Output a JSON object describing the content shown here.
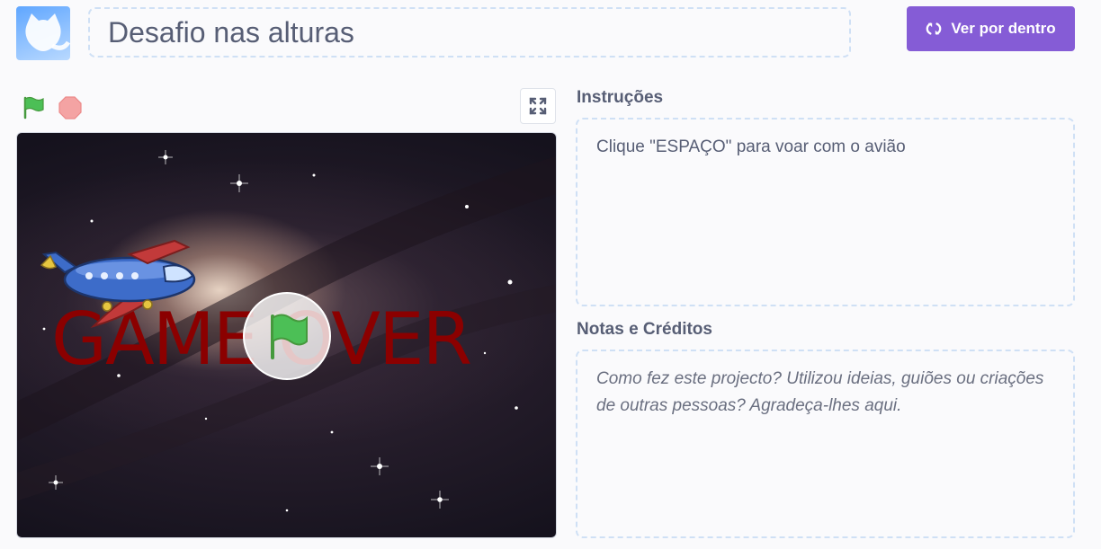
{
  "project": {
    "title": "Desafio nas alturas"
  },
  "toolbar": {
    "see_inside_label": "Ver por dentro"
  },
  "stage": {
    "overlay_text": "GAME OVER"
  },
  "instructions": {
    "heading": "Instruções",
    "text": "Clique \"ESPAÇO\" para voar com o avião"
  },
  "notes": {
    "heading": "Notas e Créditos",
    "placeholder": "Como fez este projecto? Utilizou ideias, guiões ou criações de outras pessoas? Agradeça-lhes aqui."
  },
  "colors": {
    "accent": "#855cd6",
    "flag_green": "#4cbf56",
    "stop_red": "#ec5959",
    "game_over_red": "#8b0000"
  },
  "icons": [
    "cat-avatar-icon",
    "remix-arrows-icon",
    "green-flag-icon",
    "stop-icon",
    "fullscreen-icon",
    "plane-sprite-icon"
  ]
}
